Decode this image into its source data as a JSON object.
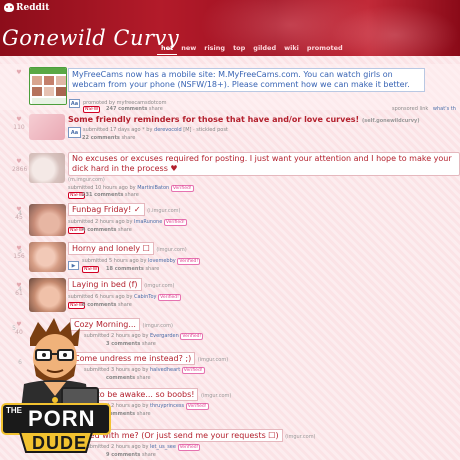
{
  "header": {
    "site_name": "Reddit",
    "subreddit_title": "Gonewild Curvy",
    "tabs": [
      "hot",
      "new",
      "rising",
      "top",
      "gilded",
      "wiki",
      "promoted"
    ],
    "active_tab": "hot"
  },
  "ad": {
    "title": "MyFreeCams now has a mobile site: M.MyFreeCams.com. You can watch girls on webcam from your phone (NSFW/18+). Please comment how we can make it better.",
    "tagline": "promoted by myfreecamsdotcom",
    "nsfw": "NSFW",
    "comments": "247 comments",
    "share": "share",
    "sponsored": "sponsored link",
    "whats_this": "what's th"
  },
  "posts": [
    {
      "rank": "",
      "score": "110",
      "title": "Some friendly reminders for those that have and/or love curves!",
      "domain": "(self.gonewildcurvy)",
      "tagline_pre": "submitted 17 days ago * by",
      "user": "derevocold",
      "tagline_post": "[M] · stickied post",
      "comments": "22 comments",
      "share": "share",
      "selfbox": "Aa"
    },
    {
      "rank": "",
      "score": "2866",
      "title": "No excuses or excuses required for posting. I just want your attention and I hope to make your dick hard in the process ♥",
      "domain": "(m.imgur.com)",
      "tagline_pre": "submitted 10 hours ago by",
      "user": "MartiniBaton",
      "flair": "Verified!",
      "nsfw": "NSFW",
      "comments": "231 comments",
      "share": "share"
    },
    {
      "rank": "4",
      "score": "45",
      "title": "Funbag Friday! ✓",
      "domain": "(i.imgur.com)",
      "tagline_pre": "submitted 2 hours ago by",
      "user": "ImaRunone",
      "flair": "Verified!",
      "nsfw": "NSFW",
      "comments": "4 comments",
      "share": "share"
    },
    {
      "rank": "3",
      "score": "156",
      "title": "Horny and lonely ☐",
      "domain": "(imgur.com)",
      "tagline_pre": "submitted 5 hours ago by",
      "user": "lovemebby",
      "flair": "Verified!",
      "nsfw": "NSFW",
      "comments": "18 comments",
      "share": "share",
      "selfbox": "▶"
    },
    {
      "rank": "4",
      "score": "61",
      "title": "Laying in bed (f)",
      "domain": "(imgur.com)",
      "tagline_pre": "submitted 6 hours ago by",
      "user": "CabinToy",
      "flair": "Verified!",
      "nsfw": "NSFW",
      "comments": "6 comments",
      "share": "share"
    },
    {
      "rank": "5",
      "score": "40",
      "title": "Cozy Morning...",
      "domain": "(imgur.com)",
      "tagline_pre": "submitted 2 hours ago by",
      "user": "Evergarden",
      "flair": "Verified!",
      "nsfw": "NSFW",
      "comments": "3 comments",
      "share": "share"
    },
    {
      "rank": "6",
      "score": "",
      "title": "Come undress me instead? ;)",
      "domain": "(imgur.com)",
      "tagline_pre": "submitted 3 hours ago by",
      "user": "halvedheart",
      "flair": "Verified!",
      "nsfw": "NSFW",
      "comments": "comments",
      "share": "share"
    },
    {
      "rank": "",
      "score": "",
      "title": "early to be awake... so boobs!",
      "domain": "(imgur.com)",
      "tagline_pre": "submitted 2 hours ago by",
      "user": "thruyprincess",
      "flair": "Verified!",
      "nsfw": "NSFW",
      "comments": "comments",
      "share": "share"
    },
    {
      "rank": "",
      "score": "",
      "title": "to bed with me? (Or just send me your requests ☐)",
      "domain": "(imgur.com)",
      "tagline_pre": "submitted 2 hours ago by",
      "user": "let_us_see",
      "flair": "Verified!",
      "nsfw": "NSFW",
      "comments": "9 comments",
      "share": "share"
    }
  ],
  "mascot": {
    "line1": "THE",
    "line2": "PORN",
    "line3": "DUDE"
  },
  "colors": {
    "header": "#b31b2a",
    "title": "#b3202d",
    "background": "#fbe3e6",
    "flair": "#e03a8c",
    "user": "#4a6ea9"
  }
}
